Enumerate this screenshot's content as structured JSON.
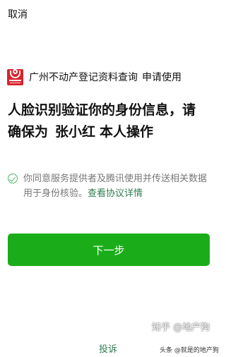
{
  "top_bar": {
    "cancel_label": "取消"
  },
  "app": {
    "logo_icon": "guangzhou-property-logo-icon",
    "logo_color": "#d8242c",
    "name": "广州不动产登记资料查询",
    "action": "申请使用"
  },
  "headline": {
    "line1": "人脸识别验证你的身份信息，请",
    "line2_prefix": "确保为",
    "person_name": "张小红",
    "line2_suffix": "本人操作"
  },
  "consent": {
    "check_icon": "check-circle-icon",
    "text": "你同意服务提供者及腾讯使用并传送相关数据用于身份核验。",
    "link": "查看协议详情"
  },
  "next_button": {
    "label": "下一步",
    "color": "#1aad19"
  },
  "footer": {
    "complain_label": "投诉"
  },
  "watermarks": {
    "zhihu": "知乎 @地产狗",
    "toutiao": "头条 @就是的地产狗"
  }
}
